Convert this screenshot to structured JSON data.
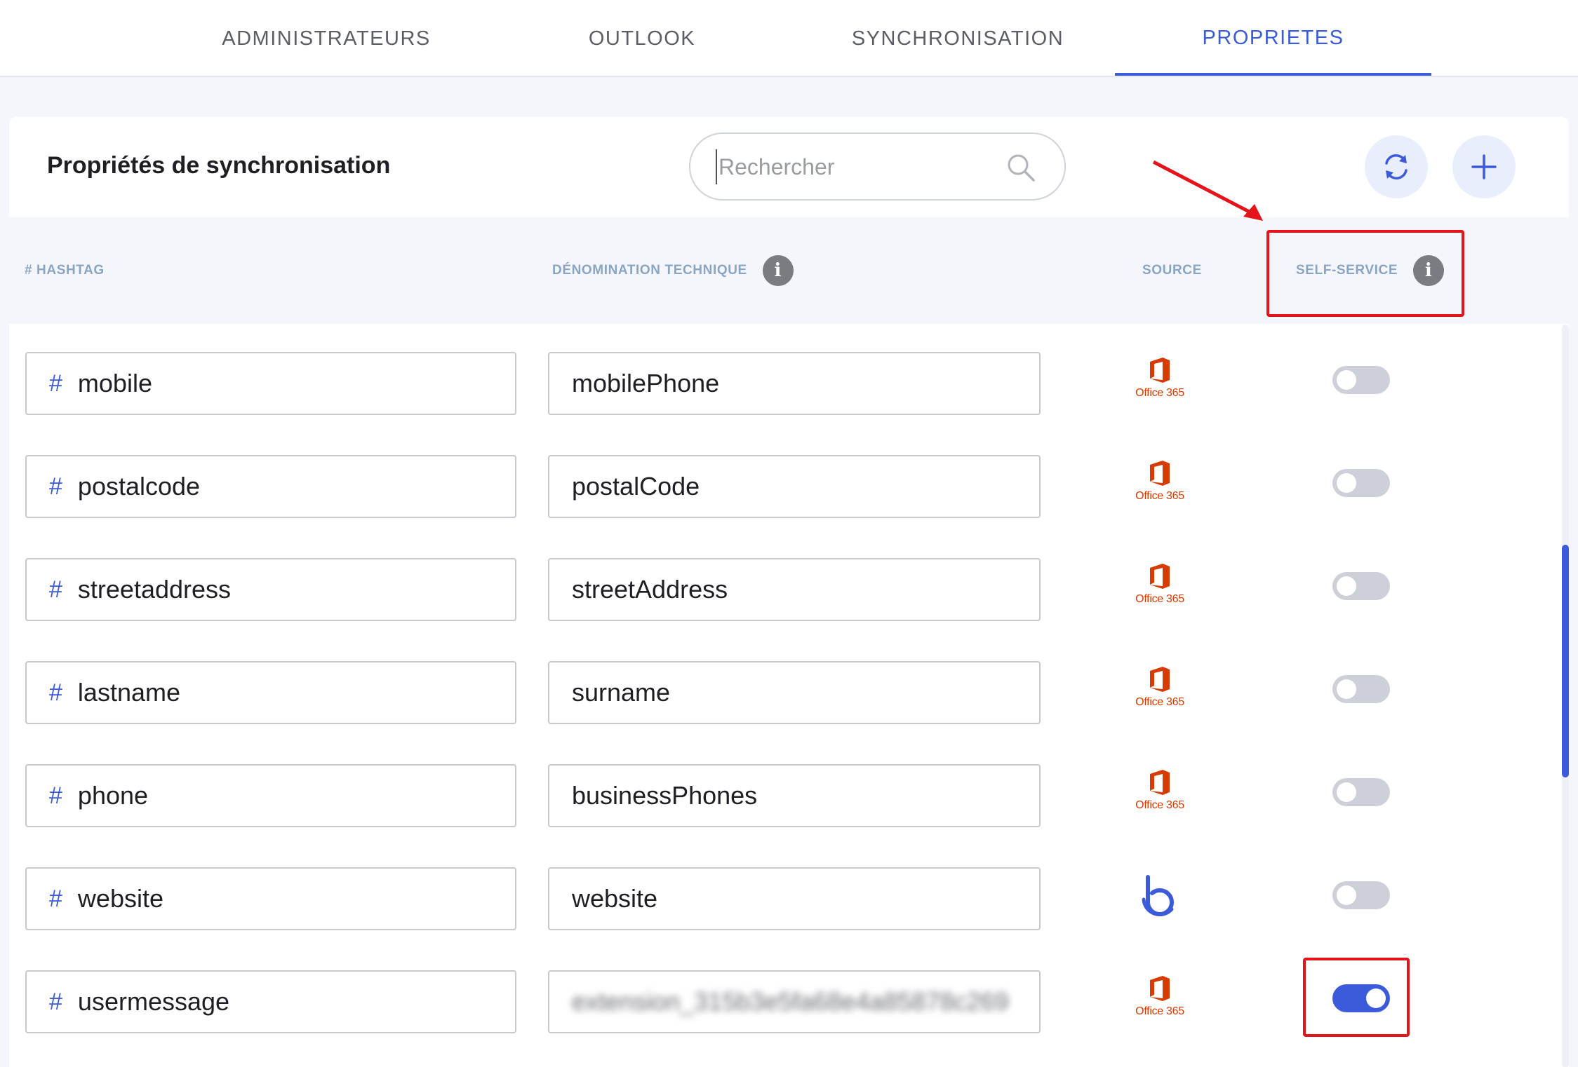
{
  "tabs": [
    {
      "label": "ADMINISTRATEURS",
      "active": false
    },
    {
      "label": "OUTLOOK",
      "active": false
    },
    {
      "label": "SYNCHRONISATION",
      "active": false
    },
    {
      "label": "PROPRIETES",
      "active": true
    }
  ],
  "card": {
    "title": "Propriétés de synchronisation",
    "search_placeholder": "Rechercher"
  },
  "columns": {
    "hashtag": "# HASHTAG",
    "technical": "DÉNOMINATION TECHNIQUE",
    "source": "SOURCE",
    "self_service": "SELF-SERVICE"
  },
  "rows": [
    {
      "hashtag": "mobile",
      "technical": "mobilePhone",
      "source": "Office 365",
      "self_service": false
    },
    {
      "hashtag": "postalcode",
      "technical": "postalCode",
      "source": "Office 365",
      "self_service": false
    },
    {
      "hashtag": "streetaddress",
      "technical": "streetAddress",
      "source": "Office 365",
      "self_service": false
    },
    {
      "hashtag": "lastname",
      "technical": "surname",
      "source": "Office 365",
      "self_service": false
    },
    {
      "hashtag": "phone",
      "technical": "businessPhones",
      "source": "Office 365",
      "self_service": false
    },
    {
      "hashtag": "website",
      "technical": "website",
      "source": "app",
      "self_service": false
    },
    {
      "hashtag": "usermessage",
      "technical": "extension_315b3e5fa68e4a85878c269",
      "source": "Office 365",
      "self_service": true
    }
  ],
  "colors": {
    "accent": "#3b5bdb",
    "highlight": "#e5141b",
    "office": "#d83b01"
  }
}
